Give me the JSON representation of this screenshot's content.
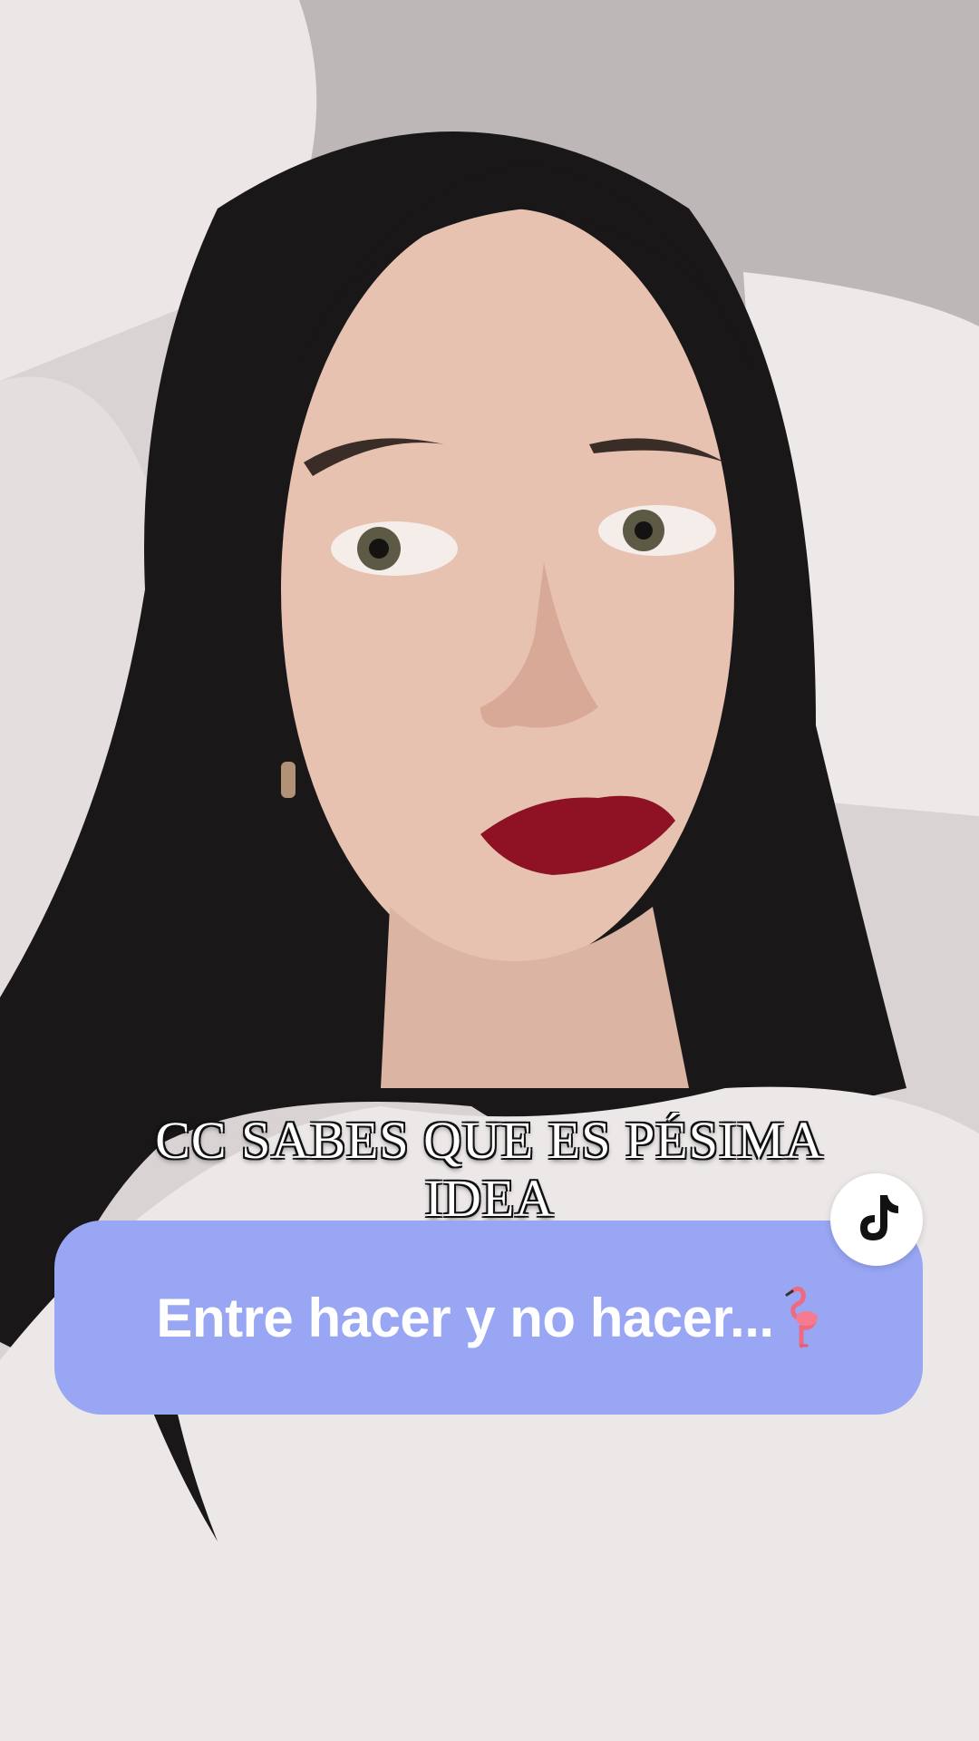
{
  "caption": {
    "text": "CC SABES QUE ES PÉSIMA IDEA"
  },
  "banner": {
    "text": "Entre hacer y no hacer...",
    "emoji_icon": "flamingo-icon",
    "background_color": "#98a6f4",
    "text_color": "#ffffff"
  },
  "badge": {
    "icon": "tiktok-logo-icon"
  }
}
